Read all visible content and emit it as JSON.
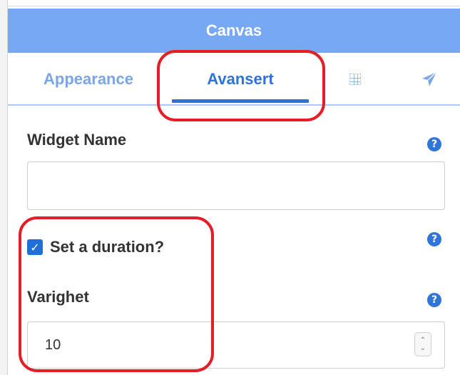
{
  "panel": {
    "title": "Canvas"
  },
  "tabs": [
    {
      "label": "Appearance",
      "active": false
    },
    {
      "label": "Avansert",
      "active": true
    },
    {
      "icon": "grid-icon"
    },
    {
      "icon": "send-icon"
    }
  ],
  "form": {
    "widget_name": {
      "label": "Widget Name",
      "value": "",
      "help": "?"
    },
    "duration_toggle": {
      "label": "Set a duration?",
      "checked": true,
      "check_mark": "✓",
      "help": "?"
    },
    "duration": {
      "label": "Varighet",
      "value": "10",
      "help": "?",
      "stepper_up": "⌃",
      "stepper_down": "⌄"
    }
  },
  "colors": {
    "header_bg": "#77a8f4",
    "active_tab": "#2d73d6",
    "inactive_tab": "#7aa6e6",
    "highlight": "#e51d26"
  }
}
